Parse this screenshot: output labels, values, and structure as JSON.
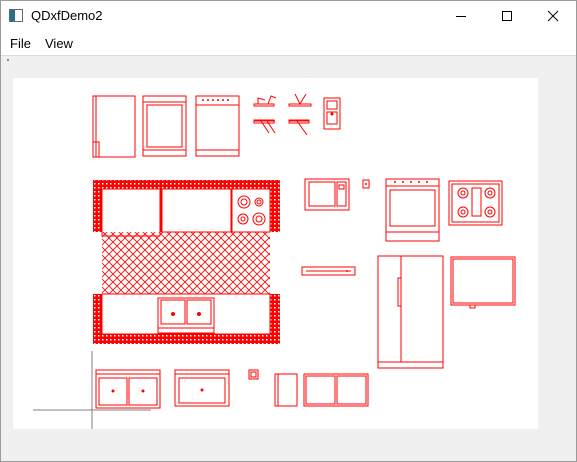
{
  "window": {
    "title": "QDxfDemo2",
    "icon": "app-window-icon",
    "controls": [
      "minimize-icon",
      "maximize-icon",
      "close-icon"
    ]
  },
  "menubar": {
    "items": [
      {
        "label": "File"
      },
      {
        "label": "View"
      }
    ]
  },
  "colors": {
    "drawing": "#ff0000",
    "cursor": "#808080",
    "canvas": "#ffffff",
    "chrome": "#f0f0f0"
  }
}
